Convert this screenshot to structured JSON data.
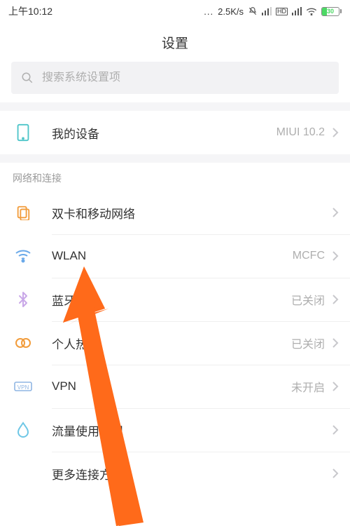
{
  "status": {
    "time": "上午10:12",
    "dots": "...",
    "net_speed": "2.5K/s",
    "battery_pct": "30"
  },
  "header": {
    "title": "设置"
  },
  "search": {
    "placeholder": "搜索系统设置项"
  },
  "device_row": {
    "label": "我的设备",
    "value": "MIUI 10.2"
  },
  "network_section": {
    "title": "网络和连接"
  },
  "rows": {
    "dual_sim": {
      "label": "双卡和移动网络",
      "value": ""
    },
    "wlan": {
      "label": "WLAN",
      "value": "MCFC"
    },
    "bluetooth": {
      "label": "蓝牙",
      "value": "已关闭"
    },
    "hotspot": {
      "label": "个人热点",
      "value": "已关闭"
    },
    "vpn": {
      "label": "VPN",
      "value": "未开启"
    },
    "data": {
      "label": "流量使用情况",
      "value": ""
    },
    "more": {
      "label": "更多连接方式",
      "value": ""
    }
  },
  "colors": {
    "accent": "#ff6a1a"
  }
}
